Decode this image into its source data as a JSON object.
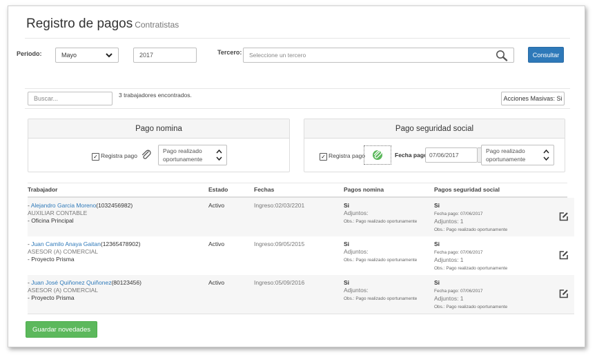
{
  "header": {
    "title": "Registro de pagos",
    "subtitle": "Contratistas"
  },
  "filters": {
    "periodo_label": "Periodo:",
    "month_value": "Mayo",
    "year_value": "2017",
    "tercero_label": "Tercero:",
    "tercero_placeholder": "Seleccione un tercero",
    "consultar_label": "Consultar"
  },
  "toolbar": {
    "search_placeholder": "Buscar...",
    "found_text": "3 trabajadores encontrados.",
    "mass_actions_label": "Acciones Masivas: Si"
  },
  "panel_nomina": {
    "title": "Pago nomina",
    "checkbox_label": "Registra pago",
    "select_line1": "Pago realizado",
    "select_line2": "oportunamente"
  },
  "panel_seguridad": {
    "title": "Pago seguridad social",
    "checkbox_label": "Registra pago",
    "fecha_label": "Fecha pago:",
    "fecha_value": "07/06/2017",
    "select_line1": "Pago realizado",
    "select_line2": "oportunamente"
  },
  "table": {
    "headers": [
      "Trabajador",
      "Estado",
      "Fechas",
      "Pagos nomina",
      "Pagos seguridad social"
    ],
    "rows": [
      {
        "name": "Alejandro Garcia Moreno",
        "doc": "(1032456982)",
        "role": "AUXILIAR CONTABLE",
        "place": "- Oficina Principal",
        "estado": "Activo",
        "fecha": "Ingreso:02/03/2201",
        "nom_si": "Si",
        "nom_adj": "Adjuntos:",
        "nom_obs": "Obs.: Pago realizado oportunamente",
        "ss_si": "Si",
        "ss_fecha": "Fecha pago: 07/06/2017",
        "ss_adj": "Adjuntos: 1",
        "ss_obs": "Obs.: Pago realizado oportunamente"
      },
      {
        "name": "Juan Camilo Anaya Gaitan",
        "doc": "(12365478902)",
        "role": "ASESOR (A) COMERCIAL",
        "place": "- Proyecto Prisma",
        "estado": "Activo",
        "fecha": "Ingreso:09/05/2015",
        "nom_si": "Si",
        "nom_adj": "Adjuntos:",
        "nom_obs": "Obs.: Pago realizado oportunamente",
        "ss_si": "Si",
        "ss_fecha": "Fecha pago: 07/06/2017",
        "ss_adj": "Adjuntos: 1",
        "ss_obs": "Obs.: Pago realizado oportunamente"
      },
      {
        "name": "Juan José Quiñonez Quiñonez",
        "doc": "(80123456)",
        "role": "ASESOR (A) COMERCIAL",
        "place": "- Proyecto Prisma",
        "estado": "Activo",
        "fecha": "Ingreso:05/09/2016",
        "nom_si": "Si",
        "nom_adj": "Adjuntos:",
        "nom_obs": "Obs.: Pago realizado oportunamente",
        "ss_si": "Si",
        "ss_fecha": "Fecha pago: 07/06/2017",
        "ss_adj": "Adjuntos: 1",
        "ss_obs": "Obs.: Pago realizado oportunamente"
      }
    ]
  },
  "footer": {
    "save_label": "Guardar novedades"
  },
  "icons": {
    "search": "search-icon",
    "paperclip": "paperclip-icon",
    "calendar": "calendar-icon",
    "edit": "edit-icon",
    "chevron": "chevron-down-icon",
    "spinner": "up-down-icon"
  },
  "colors": {
    "primary": "#2e79b9",
    "success": "#5cb85c",
    "link": "#2e79b9"
  }
}
